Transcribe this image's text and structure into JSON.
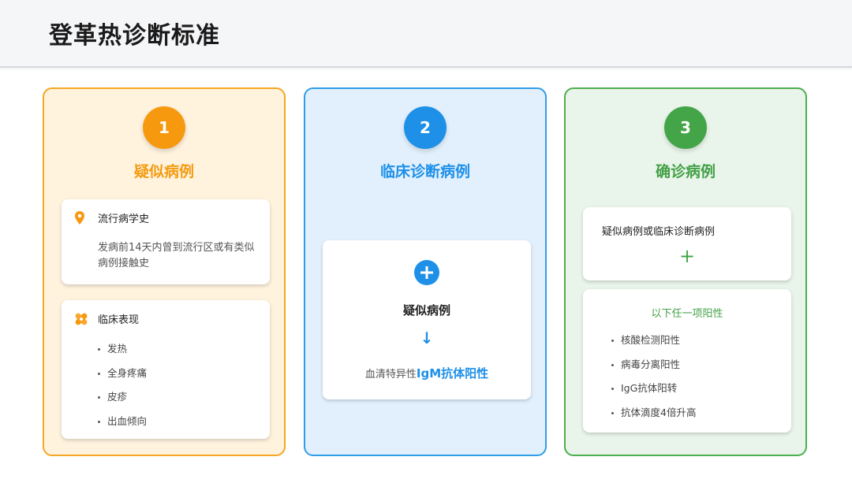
{
  "page": {
    "title": "登革热诊断标准"
  },
  "columns": [
    {
      "number": "1",
      "title": "疑似病例",
      "cards": [
        {
          "heading": "流行病学史",
          "icon": "location-pin-icon",
          "description": "发病前14天内曾到流行区或有类似病例接触史"
        },
        {
          "heading": "临床表现",
          "icon": "bandage-icon",
          "items": [
            "发热",
            "全身疼痛",
            "皮疹",
            "出血倾向"
          ]
        }
      ]
    },
    {
      "number": "2",
      "title": "临床诊断病例",
      "card": {
        "icon": "plus-circle-icon",
        "base": "疑似病例",
        "arrow": "↓",
        "test_prefix": "血清特异性",
        "test_highlight": "IgM抗体阳性"
      }
    },
    {
      "number": "3",
      "title": "确诊病例",
      "card1": {
        "text": "疑似病例或临床诊断病例",
        "plus": "+"
      },
      "card2": {
        "title": "以下任一项阳性",
        "items": [
          "核酸检测阳性",
          "病毒分离阳性",
          "IgG抗体阳转",
          "抗体滴度4倍升高"
        ]
      }
    }
  ],
  "colors": {
    "orange": "#f7990f",
    "blue": "#1e90e8",
    "green": "#43a547"
  }
}
